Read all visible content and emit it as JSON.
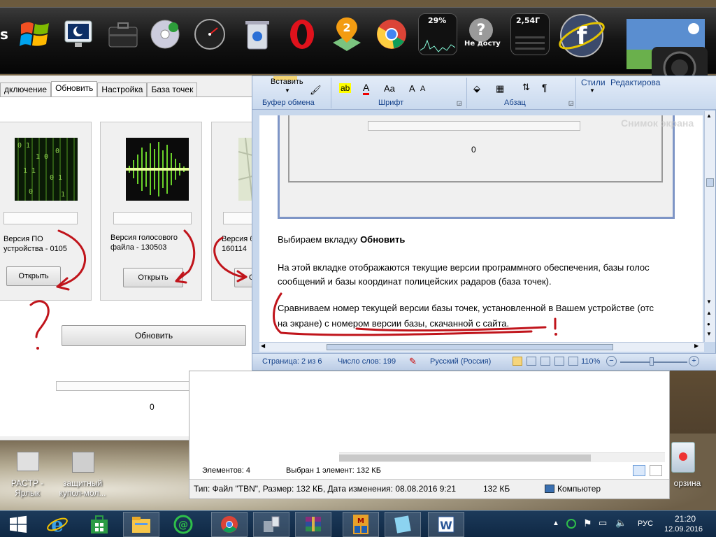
{
  "dock": {
    "items": [
      {
        "icon": "windows-flag-icon"
      },
      {
        "icon": "monitor-moon-icon"
      },
      {
        "icon": "briefcase-icon"
      },
      {
        "icon": "media-player-icon"
      },
      {
        "icon": "clock-gauge-icon"
      },
      {
        "icon": "recycle-bin-icon"
      },
      {
        "icon": "opera-icon"
      },
      {
        "icon": "map-pin-2gis-icon"
      },
      {
        "icon": "chrome-icon"
      },
      {
        "icon": "cpu-meter-icon"
      },
      {
        "icon": "unavailable-icon"
      },
      {
        "icon": "memory-meter-icon"
      },
      {
        "icon": "facebook-globe-icon"
      },
      {
        "icon": "screenshot-camera-icon"
      }
    ],
    "cpu_label": "29%",
    "unavailable_label": "Не досту",
    "memory_label": "2,54Г",
    "screenshot_watermark": "Снимок экрана"
  },
  "dialog": {
    "tabs": [
      "дключение",
      "Обновить",
      "Настройка",
      "База точек"
    ],
    "active_tab": 1,
    "cards": [
      {
        "label_line1": "Версия ПО",
        "label_line2": "устройства - 0105",
        "button": "Открыть"
      },
      {
        "label_line1": "Версия голосового",
        "label_line2": "файла - 130503",
        "button": "Открыть"
      },
      {
        "label_line1": "Версия б",
        "label_line2": "160114",
        "button": "О"
      }
    ],
    "update_button": "Обновить",
    "progress_value_text": "0"
  },
  "word": {
    "ribbon": {
      "paste_label": "Вставить",
      "groups": [
        "Буфер обмена",
        "Шрифт",
        "Абзац"
      ],
      "styles_label": "Стили",
      "editing_label": "Редактирова"
    },
    "doc": {
      "embedded_value": "0",
      "heading_prefix": "Выбираем вкладку ",
      "heading_bold": "Обновить",
      "para1_line1": "На этой вкладке отображаются  текущие версии программного обеспечения,  базы голос",
      "para1_line2": "сообщений и базы координат полицейских радаров (база точек).",
      "para2_line1": "Сравниваем номер текущей версии базы точек, установленной в Вашем устройстве  (отс",
      "para2_line2": "на экране) с номером версии базы, скачанной с сайта."
    },
    "status": {
      "page": "Страница: 2 из 6",
      "words": "Число слов: 199",
      "language": "Русский (Россия)",
      "zoom": "110%"
    }
  },
  "explorer": {
    "items_count": "Элементов: 4",
    "selected": "Выбран 1 элемент: 132 КБ",
    "file_info": "Тип: Файл \"TBN\", Размер: 132 КБ, Дата изменения: 08.08.2016 9:21",
    "size": "132 КБ",
    "location": "Компьютер"
  },
  "desktop": {
    "icons": [
      {
        "label_line1": "PACTP -",
        "label_line2": "Ярлык"
      },
      {
        "label_line1": "защитный",
        "label_line2": "купол-мол..."
      },
      {
        "label_line1": "орзина",
        "label_line2": ""
      }
    ]
  },
  "taskbar": {
    "items": [
      {
        "icon": "start-windows-icon"
      },
      {
        "icon": "internet-explorer-icon"
      },
      {
        "icon": "store-icon"
      },
      {
        "icon": "file-explorer-icon"
      },
      {
        "icon": "mail-agent-icon"
      },
      {
        "icon": "chrome-icon"
      },
      {
        "icon": "device-manager-icon"
      },
      {
        "icon": "winrar-icon"
      },
      {
        "icon": "far-manager-icon"
      },
      {
        "icon": "notepad-icon"
      },
      {
        "icon": "word-icon"
      }
    ],
    "language": "РУС",
    "time": "21:20",
    "date": "12.09.2016"
  },
  "colors": {
    "annotation_red": "#c0141b",
    "word_blue": "#15428b",
    "taskbar": "#0f2844"
  }
}
